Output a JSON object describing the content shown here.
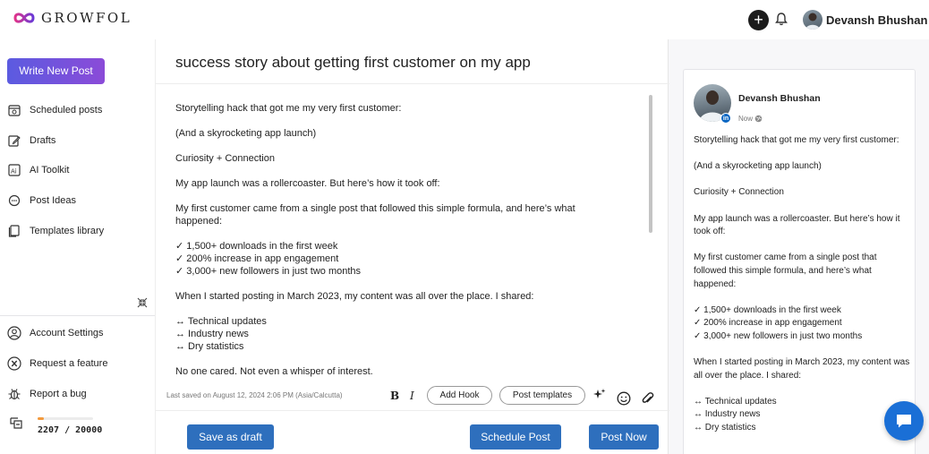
{
  "brand": {
    "name": "GROWFOL"
  },
  "topbar": {
    "user_name": "Devansh Bhushan",
    "plus_symbol": "+"
  },
  "sidebar": {
    "write_button": "Write New Post",
    "nav": [
      {
        "label": "Scheduled posts",
        "icon": "calendar-icon"
      },
      {
        "label": "Drafts",
        "icon": "edit-icon"
      },
      {
        "label": "AI Toolkit",
        "icon": "ai-icon"
      },
      {
        "label": "Post Ideas",
        "icon": "chat-bubble-icon"
      },
      {
        "label": "Templates library",
        "icon": "templates-icon"
      }
    ],
    "footer_nav": [
      {
        "label": "Account Settings",
        "icon": "user-circle-icon"
      },
      {
        "label": "Request a feature",
        "icon": "x-circle-icon"
      },
      {
        "label": "Report a bug",
        "icon": "bug-icon"
      }
    ],
    "credits": {
      "text": "2207 / 20000",
      "fraction": 0.11
    }
  },
  "editor": {
    "title": "success story about getting first customer on my app",
    "paragraphs": [
      "Storytelling hack that got me my very first customer:",
      "(And a skyrocketing app launch)",
      "Curiosity + Connection",
      "My app launch was a rollercoaster. But here’s how it took off:",
      "My first customer came from a single post that followed this simple formula, and here’s what happened:",
      "✓ 1,500+ downloads in the first week\n✓ 200% increase in app engagement\n✓ 3,000+ new followers in just two months",
      "When I started posting in March 2023, my content was all over the place. I shared:",
      "↔ Technical updates\n↔ Industry news\n↔ Dry statistics",
      "No one cared. Not even a whisper of interest."
    ],
    "last_saved": "Last saved on August 12, 2024 2:06 PM (Asia/Calcutta)",
    "bold_label": "B",
    "italic_label": "I",
    "add_hook_label": "Add Hook",
    "post_templates_label": "Post templates",
    "save_draft_label": "Save as draft",
    "schedule_label": "Schedule Post",
    "post_now_label": "Post Now"
  },
  "preview": {
    "name": "Devansh Bhushan",
    "time": "Now",
    "linkedin_badge": "in",
    "paragraphs": [
      "Storytelling hack that got me my very first customer:",
      "(And a skyrocketing app launch)",
      "Curiosity + Connection",
      "My app launch was a rollercoaster. But here’s how it took off:",
      "My first customer came from a single post that followed this simple formula, and here’s what happened:",
      "✓ 1,500+ downloads in the first week\n✓ 200% increase in app engagement\n✓ 3,000+ new followers in just two months",
      "When I started posting in March 2023, my content was all over the place. I shared:",
      "↔ Technical updates\n↔ Industry news\n↔ Dry statistics"
    ]
  },
  "colors": {
    "write_button_gradient": [
      "#5b5be0",
      "#8b4bd8"
    ],
    "primary_blue": "#2e6fbd",
    "chat_fab": "#1a6fd6",
    "credit_fill": "#f39a3d",
    "linkedin": "#0a66c2"
  }
}
